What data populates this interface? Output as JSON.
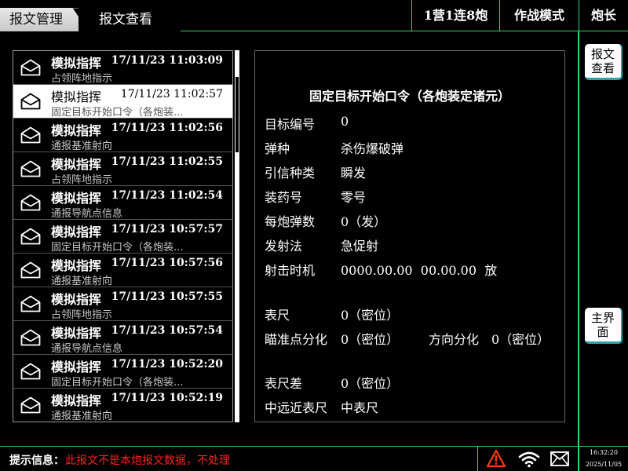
{
  "header": {
    "tab_manage": "报文管理",
    "tab_view": "报文查看",
    "battalion": "1营1连8炮",
    "mode": "作战模式",
    "role": "炮长"
  },
  "sidebar": {
    "view_btn": "报文查看",
    "main_btn": "主界面"
  },
  "messages": [
    {
      "title": "模拟指挥",
      "time": "17/11/23 11:03:09",
      "sub": "占领阵地指示"
    },
    {
      "title": "模拟指挥",
      "time": "17/11/23 11:02:57",
      "sub": "固定目标开始口令（各炮装..."
    },
    {
      "title": "模拟指挥",
      "time": "17/11/23 11:02:56",
      "sub": "通报基准射向"
    },
    {
      "title": "模拟指挥",
      "time": "17/11/23 11:02:55",
      "sub": "占领阵地指示"
    },
    {
      "title": "模拟指挥",
      "time": "17/11/23 11:02:54",
      "sub": "通报导航点信息"
    },
    {
      "title": "模拟指挥",
      "time": "17/11/23 10:57:57",
      "sub": "固定目标开始口令（各炮装..."
    },
    {
      "title": "模拟指挥",
      "time": "17/11/23 10:57:56",
      "sub": "通报基准射向"
    },
    {
      "title": "模拟指挥",
      "time": "17/11/23 10:57:55",
      "sub": "占领阵地指示"
    },
    {
      "title": "模拟指挥",
      "time": "17/11/23 10:57:54",
      "sub": "通报导航点信息"
    },
    {
      "title": "模拟指挥",
      "time": "17/11/23 10:52:20",
      "sub": "固定目标开始口令（各炮装..."
    },
    {
      "title": "模拟指挥",
      "time": "17/11/23 10:52:19",
      "sub": "通报基准射向"
    }
  ],
  "detail": {
    "title": "固定目标开始口令（各炮装定诸元）",
    "target_no_label": "目标编号",
    "target_no": "0",
    "ammo_label": "弹种",
    "ammo": "杀伤爆破弹",
    "fuse_label": "引信种类",
    "fuse": "瞬发",
    "charge_label": "装药号",
    "charge": "零号",
    "rounds_label": "每炮弹数",
    "rounds": "0（发）",
    "fire_method_label": "发射法",
    "fire_method": "急促射",
    "fire_time_label": "射击时机",
    "fire_time": "0000.00.00  00.00.00  放",
    "scale_label": "表尺",
    "scale": "0（密位）",
    "aim_label": "瞄准点分化",
    "aim": "0（密位）",
    "dir_label": "方向分化",
    "dir": "0（密位）",
    "scale_diff_label": "表尺差",
    "scale_diff": "0（密位）",
    "mid_scale_label": "中远近表尺",
    "mid_scale": "中表尺"
  },
  "status": {
    "label": "提示信息：",
    "message": "此报文不是本炮报文数据，不处理",
    "time": "16:32:20",
    "date": "2025/11/05"
  },
  "icons": {
    "warning": "warning-icon",
    "wifi": "wifi-icon",
    "mail": "mail-icon"
  },
  "colors": {
    "accent": "#2fd86f",
    "alert": "#ff2020",
    "selected_bg": "#ffffff"
  }
}
